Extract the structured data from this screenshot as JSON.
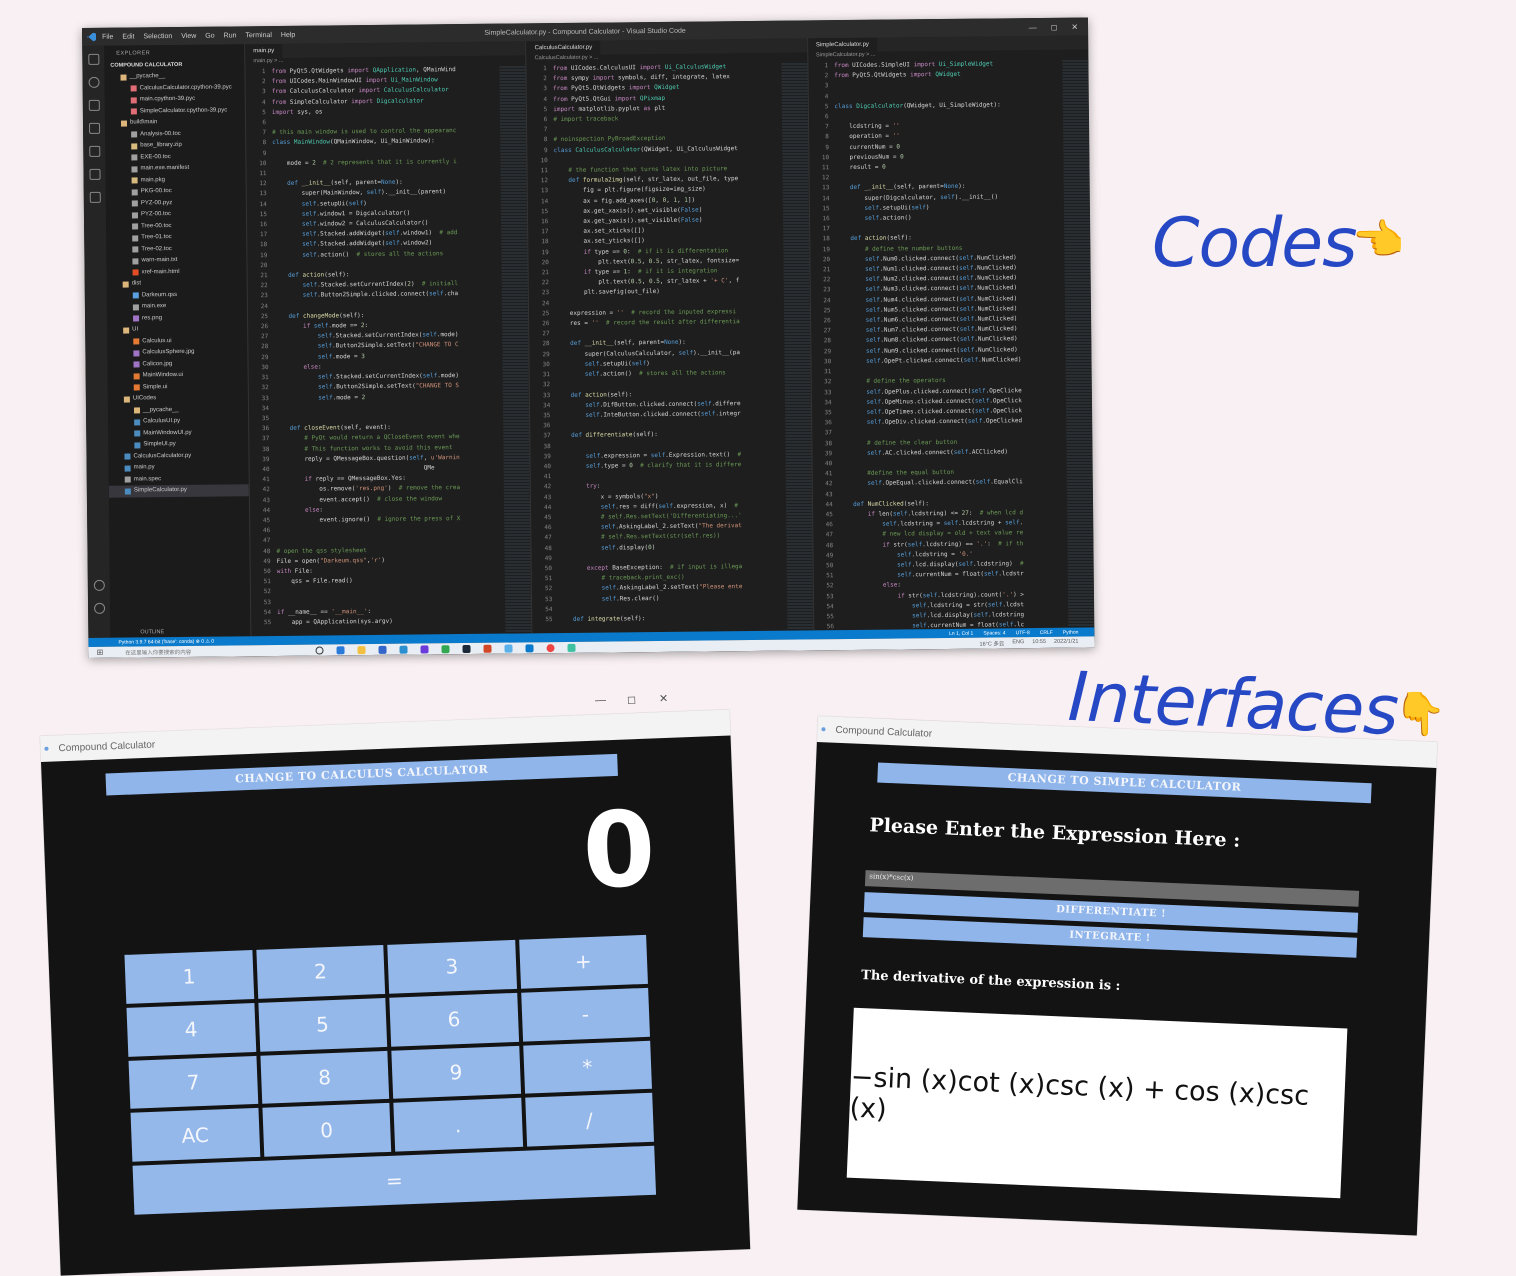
{
  "vscode": {
    "window_title": "SimpleCalculator.py - Compound Calculator - Visual Studio Code",
    "menu": [
      "File",
      "Edit",
      "Selection",
      "View",
      "Go",
      "Run",
      "Terminal",
      "Help"
    ],
    "win_controls": [
      "—",
      "◻",
      "✕"
    ],
    "explorer_header": "EXPLORER",
    "project_name": "COMPOUND CALCULATOR",
    "outline_label": "OUTLINE",
    "tree": [
      {
        "name": "__pycache__",
        "type": "folder",
        "depth": 1
      },
      {
        "name": "CalculusCalculator.cpython-39.pyc",
        "type": "pyc",
        "depth": 2
      },
      {
        "name": "main.cpython-39.pyc",
        "type": "pyc",
        "depth": 2
      },
      {
        "name": "SimpleCalculator.cpython-39.pyc",
        "type": "pyc",
        "depth": 2
      },
      {
        "name": "build\\main",
        "type": "folder",
        "depth": 1
      },
      {
        "name": "Analysis-00.toc",
        "type": "file",
        "depth": 2
      },
      {
        "name": "base_library.zip",
        "type": "zip",
        "depth": 2
      },
      {
        "name": "EXE-00.toc",
        "type": "file",
        "depth": 2
      },
      {
        "name": "main.exe.manifest",
        "type": "file",
        "depth": 2
      },
      {
        "name": "main.pkg",
        "type": "zip",
        "depth": 2
      },
      {
        "name": "PKG-00.toc",
        "type": "file",
        "depth": 2
      },
      {
        "name": "PYZ-00.pyz",
        "type": "file",
        "depth": 2
      },
      {
        "name": "PYZ-00.toc",
        "type": "file",
        "depth": 2
      },
      {
        "name": "Tree-00.toc",
        "type": "file",
        "depth": 2
      },
      {
        "name": "Tree-01.toc",
        "type": "file",
        "depth": 2
      },
      {
        "name": "Tree-02.toc",
        "type": "file",
        "depth": 2
      },
      {
        "name": "warn-main.txt",
        "type": "file",
        "depth": 2
      },
      {
        "name": "xref-main.html",
        "type": "html",
        "depth": 2
      },
      {
        "name": "dist",
        "type": "folder",
        "depth": 1
      },
      {
        "name": "Darkeum.qss",
        "type": "qss",
        "depth": 2
      },
      {
        "name": "main.exe",
        "type": "file",
        "depth": 2
      },
      {
        "name": "res.png",
        "type": "img",
        "depth": 2
      },
      {
        "name": "UI",
        "type": "folder",
        "depth": 1
      },
      {
        "name": "Calculus.ui",
        "type": "ui",
        "depth": 2
      },
      {
        "name": "CalculusSphere.jpg",
        "type": "img",
        "depth": 2
      },
      {
        "name": "Calicon.jpg",
        "type": "img",
        "depth": 2
      },
      {
        "name": "MainWindow.ui",
        "type": "ui",
        "depth": 2
      },
      {
        "name": "Simple.ui",
        "type": "ui",
        "depth": 2
      },
      {
        "name": "UICodes",
        "type": "folder",
        "depth": 1
      },
      {
        "name": "__pycache__",
        "type": "folder",
        "depth": 2
      },
      {
        "name": "CalculusUI.py",
        "type": "py",
        "depth": 2
      },
      {
        "name": "MainWindowUI.py",
        "type": "py",
        "depth": 2
      },
      {
        "name": "SimpleUI.py",
        "type": "py",
        "depth": 2
      },
      {
        "name": "CalculusCalculator.py",
        "type": "py",
        "depth": 1
      },
      {
        "name": "main.py",
        "type": "py",
        "depth": 1
      },
      {
        "name": "main.spec",
        "type": "file",
        "depth": 1
      },
      {
        "name": "SimpleCalculator.py",
        "type": "py",
        "depth": 1,
        "selected": true
      }
    ],
    "panes": [
      {
        "tab": "main.py",
        "crumb": "main.py > ...",
        "lines": [
          "<span class='kw'>from</span> PyQt5.QtWidgets <span class='kw'>import</span> <span class='cls'>QApplication</span>, QMainWind",
          "<span class='kw'>from</span> UICodes.MainWindowUI <span class='kw'>import</span> <span class='cls'>Ui_MainWindow</span>",
          "<span class='kw'>from</span> CalculusCalculator <span class='kw'>import</span> <span class='cls'>CalculusCalculator</span>",
          "<span class='kw'>from</span> SimpleCalculator <span class='kw'>import</span> <span class='cls'>Digcalculator</span>",
          "<span class='kw'>import</span> sys, os",
          "",
          "<span class='cm'># this main window is used to control the appearanc</span>",
          "<span class='self'>class</span> <span class='cls'>MainWindow</span>(QMainWindow, Ui_MainWindow):",
          "",
          "    mode = <span class='num'>2</span>  <span class='cm'># 2 represents that it is currently i</span>",
          "",
          "    <span class='self'>def</span> <span class='fn'>__init__</span>(self, parent=<span class='self'>None</span>):",
          "        super(MainWindow, <span class='self'>self</span>).__init__(parent)",
          "        <span class='self'>self</span>.setupUi(<span class='self'>self</span>)",
          "        <span class='self'>self</span>.window1 = Digcalculator()",
          "        <span class='self'>self</span>.window2 = CalculusCalculator()",
          "        <span class='self'>self</span>.Stacked.addWidget(<span class='self'>self</span>.window1)  <span class='cm'># add</span>",
          "        <span class='self'>self</span>.Stacked.addWidget(<span class='self'>self</span>.window2)",
          "        <span class='self'>self</span>.action()  <span class='cm'># stores all the actions</span>",
          "",
          "    <span class='self'>def</span> <span class='fn'>action</span>(self):",
          "        <span class='self'>self</span>.Stacked.setCurrentIndex(<span class='num'>2</span>)  <span class='cm'># initiall</span>",
          "        <span class='self'>self</span>.Button2Simple.clicked.connect(<span class='self'>self</span>.cha",
          "",
          "    <span class='self'>def</span> <span class='fn'>changeMode</span>(self):",
          "        <span class='kw'>if</span> <span class='self'>self</span>.mode == <span class='num'>2</span>:",
          "            <span class='self'>self</span>.Stacked.setCurrentIndex(<span class='self'>self</span>.mode)",
          "            <span class='self'>self</span>.Button2Simple.setText(<span class='str'>\"CHANGE TO C</span>",
          "            <span class='self'>self</span>.mode = <span class='num'>3</span>",
          "        <span class='kw'>else</span>:",
          "            <span class='self'>self</span>.Stacked.setCurrentIndex(<span class='self'>self</span>.mode)",
          "            <span class='self'>self</span>.Button2Simple.setText(<span class='str'>\"CHANGE TO S</span>",
          "            <span class='self'>self</span>.mode = <span class='num'>2</span>",
          "",
          "",
          "    <span class='self'>def</span> <span class='fn'>closeEvent</span>(self, event):",
          "        <span class='cm'># PyQt would return a QCloseEvent event whe</span>",
          "        <span class='cm'># This function works to avoid this event</span>",
          "        reply = QMessageBox.question(<span class='self'>self</span>, <span class='str'>u'Warnin</span>",
          "                                         QMe",
          "        <span class='kw'>if</span> reply == QMessageBox.Yes:",
          "            os.remove(<span class='str'>'res.png'</span>)  <span class='cm'># remove the crea</span>",
          "            event.accept()  <span class='cm'># close the window</span>",
          "        <span class='kw'>else</span>:",
          "            event.ignore()  <span class='cm'># ignore the press of X</span>",
          "",
          "",
          "<span class='cm'># open the qss stylesheet</span>",
          "File = open(<span class='str'>\"Darkeum.qss\"</span>,<span class='str'>'r'</span>)",
          "<span class='kw'>with</span> File:",
          "    qss = File.read()",
          "",
          "",
          "<span class='kw'>if</span> __name__ == <span class='str'>'__main__'</span>:",
          "    app = QApplication(sys.argv)"
        ]
      },
      {
        "tab": "CalculusCalculator.py",
        "crumb": "CalculusCalculator.py > ...",
        "lines": [
          "<span class='kw'>from</span> UICodes.CalculusUI <span class='kw'>import</span> <span class='cls'>Ui_CalculusWidget</span>",
          "<span class='kw'>from</span> sympy <span class='kw'>import</span> symbols, diff, integrate, latex",
          "<span class='kw'>from</span> PyQt5.QtWidgets <span class='kw'>import</span> <span class='cls'>QWidget</span>",
          "<span class='kw'>from</span> PyQt5.QtGui <span class='kw'>import</span> <span class='cls'>QPixmap</span>",
          "<span class='kw'>import</span> matplotlib.pyplot <span class='kw'>as</span> plt",
          "<span class='cm'># import traceback</span>",
          "",
          "<span class='cm'># noinspection PyBroadException</span>",
          "<span class='self'>class</span> <span class='cls'>CalculusCalculator</span>(QWidget, Ui_CalculusWidget",
          "",
          "    <span class='cm'># the function that turns latex into picture</span>",
          "    <span class='self'>def</span> <span class='fn'>formula2img</span>(self, str_latex, out_file, type",
          "        fig = plt.figure(figsize=img_size)",
          "        ax = fig.add_axes([<span class='num'>0</span>, <span class='num'>0</span>, <span class='num'>1</span>, <span class='num'>1</span>])",
          "        ax.get_xaxis().set_visible(<span class='self'>False</span>)",
          "        ax.get_yaxis().set_visible(<span class='self'>False</span>)",
          "        ax.set_xticks([])",
          "        ax.set_yticks([])",
          "        <span class='kw'>if</span> type == <span class='num'>0</span>:  <span class='cm'># if it is differentation</span>",
          "            plt.text(<span class='num'>0.5</span>, <span class='num'>0.5</span>, str_latex, fontsize=",
          "        <span class='kw'>if</span> type == <span class='num'>1</span>:  <span class='cm'># if it is integration</span>",
          "            plt.text(<span class='num'>0.5</span>, <span class='num'>0.5</span>, str_latex + <span class='str'>'+ C'</span>, f",
          "        plt.savefig(out_file)",
          "",
          "    expression = <span class='str'>''</span>  <span class='cm'># record the inputed expressi</span>",
          "    res = <span class='str'>''</span>  <span class='cm'># record the result after differentia</span>",
          "",
          "    <span class='self'>def</span> <span class='fn'>__init__</span>(self, parent=<span class='self'>None</span>):",
          "        super(CalculusCalculator, <span class='self'>self</span>).__init__(pa",
          "        <span class='self'>self</span>.setupUi(<span class='self'>self</span>)",
          "        <span class='self'>self</span>.action()  <span class='cm'># stores all the actions</span>",
          "",
          "    <span class='self'>def</span> <span class='fn'>action</span>(self):",
          "        <span class='self'>self</span>.DifButton.clicked.connect(<span class='self'>self</span>.differe",
          "        <span class='self'>self</span>.InteButton.clicked.connect(<span class='self'>self</span>.integr",
          "",
          "    <span class='self'>def</span> <span class='fn'>differentiate</span>(self):",
          "",
          "        <span class='self'>self</span>.expression = <span class='self'>self</span>.Expression.text()  <span class='cm'>#</span>",
          "        <span class='self'>self</span>.type = <span class='num'>0</span>  <span class='cm'># clarify that it is differe</span>",
          "",
          "        <span class='kw'>try</span>:",
          "            x = symbols(<span class='str'>\"x\"</span>)",
          "            <span class='self'>self</span>.res = diff(<span class='self'>self</span>.expression, x)  <span class='cm'>#</span>",
          "            <span class='cm'># self.Res.setText('Differentiating...'</span>",
          "            <span class='self'>self</span>.AskingLabel_2.setText(<span class='str'>\"The derivat</span>",
          "            <span class='cm'># self.Res.setText(str(self.res))</span>",
          "            <span class='self'>self</span>.display(<span class='num'>0</span>)",
          "",
          "        <span class='kw'>except</span> BaseException:  <span class='cm'># if input is illega</span>",
          "            <span class='cm'># traceback.print_exc()</span>",
          "            <span class='self'>self</span>.AskingLabel_2.setText(<span class='str'>\"Please ente</span>",
          "            <span class='self'>self</span>.Res.clear()",
          "",
          "    <span class='self'>def</span> <span class='fn'>integrate</span>(self):"
        ]
      },
      {
        "tab": "SimpleCalculator.py",
        "crumb": "SimpleCalculator.py > ...",
        "lines": [
          "<span class='kw'>from</span> UICodes.SimpleUI <span class='kw'>import</span> <span class='cls'>Ui_SimpleWidget</span>",
          "<span class='kw'>from</span> PyQt5.QtWidgets <span class='kw'>import</span> <span class='cls'>QWidget</span>",
          "",
          "",
          "<span class='self'>class</span> <span class='cls'>Digcalculator</span>(QWidget, Ui_SimpleWidget):",
          "",
          "    lcdstring = <span class='str'>''</span>",
          "    operation = <span class='str'>''</span>",
          "    currentNum = <span class='num'>0</span>",
          "    previousNum = <span class='num'>0</span>",
          "    result = <span class='num'>0</span>",
          "",
          "    <span class='self'>def</span> <span class='fn'>__init__</span>(self, parent=<span class='self'>None</span>):",
          "        super(Digcalculator, <span class='self'>self</span>).__init__()",
          "        <span class='self'>self</span>.setupUi(<span class='self'>self</span>)",
          "        <span class='self'>self</span>.action()",
          "",
          "    <span class='self'>def</span> <span class='fn'>action</span>(self):",
          "        <span class='cm'># define the number buttons</span>",
          "        <span class='self'>self</span>.Num0.clicked.connect(<span class='self'>self</span>.NumClicked)",
          "        <span class='self'>self</span>.Num1.clicked.connect(<span class='self'>self</span>.NumClicked)",
          "        <span class='self'>self</span>.Num2.clicked.connect(<span class='self'>self</span>.NumClicked)",
          "        <span class='self'>self</span>.Num3.clicked.connect(<span class='self'>self</span>.NumClicked)",
          "        <span class='self'>self</span>.Num4.clicked.connect(<span class='self'>self</span>.NumClicked)",
          "        <span class='self'>self</span>.Num5.clicked.connect(<span class='self'>self</span>.NumClicked)",
          "        <span class='self'>self</span>.Num6.clicked.connect(<span class='self'>self</span>.NumClicked)",
          "        <span class='self'>self</span>.Num7.clicked.connect(<span class='self'>self</span>.NumClicked)",
          "        <span class='self'>self</span>.Num8.clicked.connect(<span class='self'>self</span>.NumClicked)",
          "        <span class='self'>self</span>.Num9.clicked.connect(<span class='self'>self</span>.NumClicked)",
          "        <span class='self'>self</span>.OpePt.clicked.connect(<span class='self'>self</span>.NumClicked)",
          "",
          "        <span class='cm'># define the operators</span>",
          "        <span class='self'>self</span>.OpePlus.clicked.connect(<span class='self'>self</span>.OpeClicke",
          "        <span class='self'>self</span>.OpeMinus.clicked.connect(<span class='self'>self</span>.OpeClick",
          "        <span class='self'>self</span>.OpeTimes.clicked.connect(<span class='self'>self</span>.OpeClick",
          "        <span class='self'>self</span>.OpeDiv.clicked.connect(<span class='self'>self</span>.OpeClicked",
          "",
          "        <span class='cm'># define the clear button</span>",
          "        <span class='self'>self</span>.AC.clicked.connect(<span class='self'>self</span>.ACClicked)",
          "",
          "        <span class='cm'>#define the equal button</span>",
          "        <span class='self'>self</span>.OpeEqual.clicked.connect(<span class='self'>self</span>.EqualCli",
          "",
          "    <span class='self'>def</span> <span class='fn'>NumClicked</span>(self):",
          "        <span class='kw'>if</span> len(<span class='self'>self</span>.lcdstring) <= <span class='num'>27</span>:  <span class='cm'># when lcd d</span>",
          "            <span class='self'>self</span>.lcdstring = <span class='self'>self</span>.lcdstring + <span class='self'>self</span>.",
          "            <span class='cm'># new lcd display = old + text value re</span>",
          "            <span class='kw'>if</span> str(<span class='self'>self</span>.lcdstring) == <span class='str'>'.'</span>:  <span class='cm'># if th</span>",
          "                <span class='self'>self</span>.lcdstring = <span class='str'>'0.'</span>",
          "                <span class='self'>self</span>.lcd.display(<span class='self'>self</span>.lcdstring)  <span class='cm'>#</span>",
          "                <span class='self'>self</span>.currentNum = float(<span class='self'>self</span>.lcdstr",
          "            <span class='kw'>else</span>:",
          "                <span class='kw'>if</span> str(<span class='self'>self</span>.lcdstring).count(<span class='str'>'.'</span>) >",
          "                    <span class='self'>self</span>.lcdstring = str(<span class='self'>self</span>.lcdst",
          "                    <span class='self'>self</span>.lcd.display(<span class='self'>self</span>.lcdstring",
          "                    <span class='self'>self</span>.currentNum = float(<span class='self'>self</span>.lc"
        ]
      }
    ],
    "status_left": "Python 3.9.7 64-bit ('base': conda)   ⊗ 0 ⚠ 0",
    "status_right": [
      "Ln 1, Col 1",
      "Spaces: 4",
      "UTF-8",
      "CRLF",
      "Python"
    ],
    "taskbar_search": "在这里输入你要搜索的内容",
    "taskbar_weather": "16°C 多云",
    "taskbar_lang": "ENG",
    "taskbar_time": "10:55",
    "taskbar_date": "2022/1/21"
  },
  "labels": {
    "codes": "Codes",
    "interfaces": "Interfaces",
    "codes_hand": "👈",
    "interfaces_hand": "👇"
  },
  "simple_calc": {
    "title": "Compound Calculator",
    "switch_label": "CHANGE TO CALCULUS CALCULATOR",
    "display_value": "0",
    "keys": [
      "1",
      "2",
      "3",
      "+",
      "4",
      "5",
      "6",
      "-",
      "7",
      "8",
      "9",
      "*",
      "AC",
      "0",
      ".",
      "/",
      "="
    ]
  },
  "calculus_calc": {
    "title": "Compound Calculator",
    "switch_label": "CHANGE TO SIMPLE CALCULATOR",
    "prompt": "Please Enter the Expression Here :",
    "expression": "sin(x)*csc(x)",
    "differentiate_label": "DIFFERENTIATE !",
    "integrate_label": "INTEGRATE !",
    "result_label": "The derivative of the expression is :",
    "result": "−sin (x)cot (x)csc (x) + cos (x)csc (x)"
  },
  "colors": {
    "accent_blue": "#8fb5ea",
    "label_blue": "#2648c4",
    "calc_bg": "#131313"
  }
}
